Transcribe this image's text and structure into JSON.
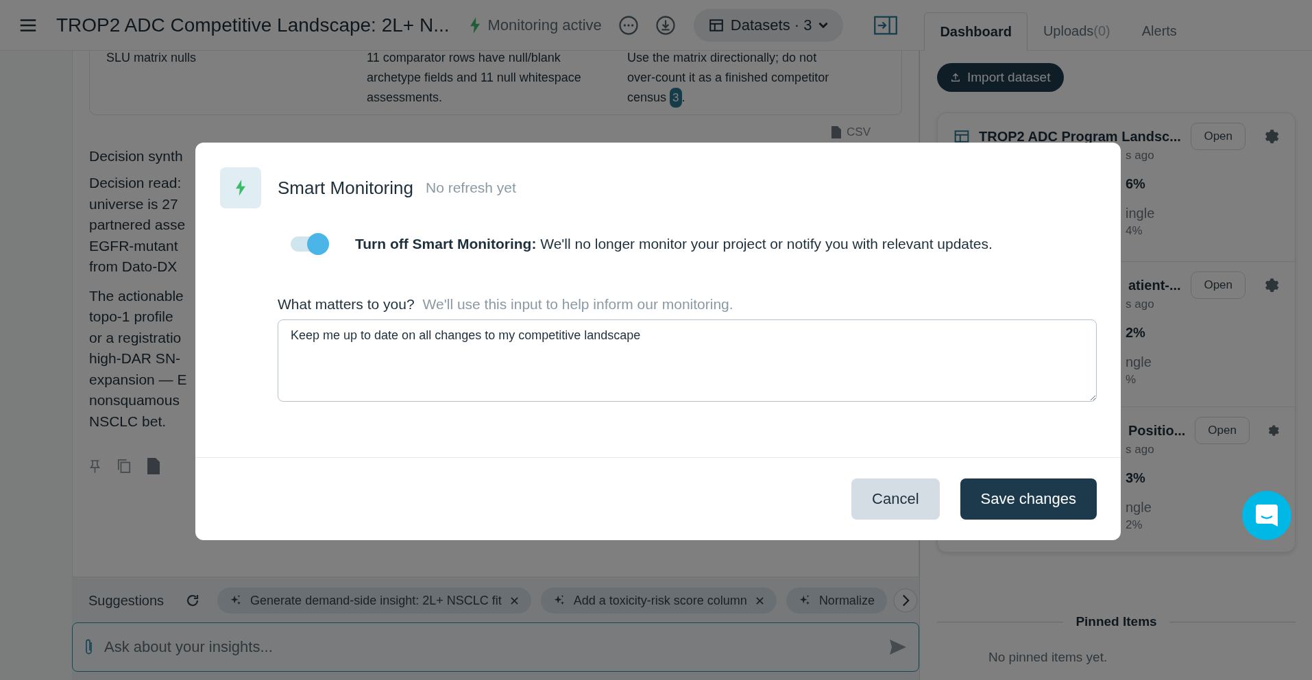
{
  "header": {
    "title": "TROP2 ADC Competitive Landscape: 2L+ N...",
    "monitoring": {
      "label": "Monitoring active",
      "on": true
    },
    "datasets_button": "Datasets · 3",
    "tabs": [
      {
        "label": "Dashboard",
        "selected": true
      },
      {
        "label": "Uploads",
        "count": "(0)",
        "selected": false
      },
      {
        "label": "Alerts",
        "selected": false
      }
    ]
  },
  "findings_table": {
    "rows": [
      {
        "cells": [
          [
            "SLU matrix nulls"
          ],
          [
            "11 comparator rows have null/blank",
            "archetype fields and 11 null whitespace",
            "assessments."
          ],
          [
            "Use the matrix directionally; do not",
            "over-count it as a finished competitor"
          ]
        ],
        "last_line": "census",
        "citation": "3",
        "after_citation": "."
      }
    ]
  },
  "csv_link": "CSV",
  "decision": {
    "heading": "Decision synth",
    "paragraphs": [
      [
        "Decision read:",
        "universe is 27",
        "partnered asse",
        "EGFR-mutant",
        "from Dato-DX"
      ],
      [
        "The actionable",
        "topo-1 profile",
        "or a registratio",
        "high-DAR SN-",
        "expansion — E",
        "nonsquamous",
        "NSCLC bet."
      ]
    ]
  },
  "suggestions": {
    "label": "Suggestions",
    "chips": [
      "Generate demand-side insight: 2L+ NSCLC fit",
      "Add a toxicity-risk score column",
      "Normalize"
    ]
  },
  "chat_input": {
    "placeholder": "Ask about your insights..."
  },
  "sidebar": {
    "import_button": "Import dataset",
    "datasets": [
      {
        "title": "TROP2 ADC Program Landsc...",
        "meta": "s ago",
        "stat": "6%",
        "label": "ingle",
        "sub": "4%",
        "open": "Open"
      },
      {
        "title": "atient-...",
        "meta": "s ago",
        "stat": "2%",
        "label": "ngle",
        "sub": "%",
        "open": "Open"
      },
      {
        "title": "Positio...",
        "meta": "s ago",
        "stat": "3%",
        "label": "ngle",
        "sub": "2%",
        "open": "Open"
      }
    ],
    "pinned_title": "Pinned Items",
    "pinned_empty": "No pinned items yet."
  },
  "dialog": {
    "title": "Smart Monitoring",
    "status": "No refresh yet",
    "toggle": {
      "on": true,
      "label": "Turn off Smart Monitoring:",
      "description": "We'll no longer monitor your project or notify you with relevant updates."
    },
    "question": "What matters to you?",
    "hint": "We'll use this input to help inform our monitoring.",
    "value": "Keep me up to date on all changes to my competitive landscape",
    "buttons": [
      {
        "kind": "secondary",
        "label": "Cancel"
      },
      {
        "kind": "primary",
        "label": "Save changes"
      }
    ]
  }
}
